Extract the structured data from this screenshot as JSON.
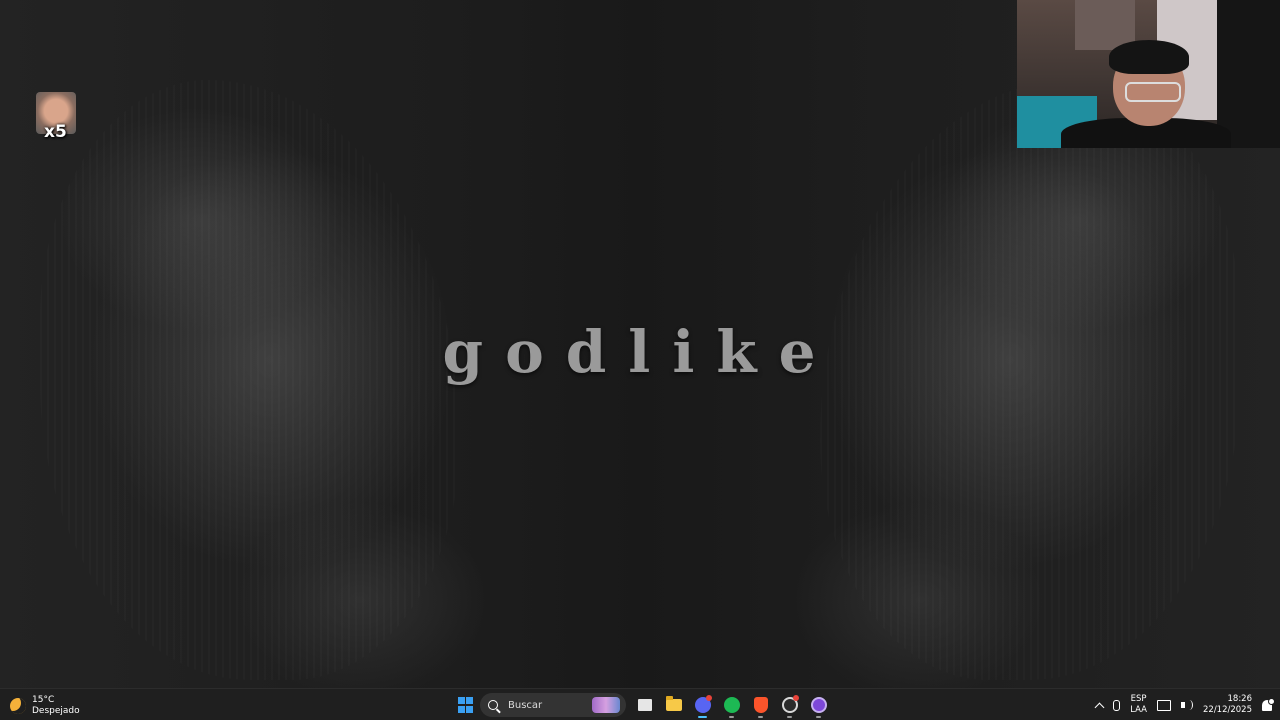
{
  "wallpaper": {
    "headline": "godlike"
  },
  "desktop_icons": [
    {
      "label": "x5"
    }
  ],
  "taskbar": {
    "weather": {
      "temp": "15°C",
      "condition": "Despejado",
      "icon": "moon-icon"
    },
    "search": {
      "placeholder": "Buscar"
    },
    "apps": [
      {
        "name": "task-view",
        "icon": "task-view-icon"
      },
      {
        "name": "file-explorer",
        "icon": "folder-icon"
      },
      {
        "name": "discord",
        "icon": "discord-icon"
      },
      {
        "name": "spotify",
        "icon": "spotify-icon"
      },
      {
        "name": "brave",
        "icon": "brave-icon"
      },
      {
        "name": "steam",
        "icon": "steam-icon"
      },
      {
        "name": "obs",
        "icon": "obs-icon"
      }
    ],
    "tray": {
      "language": "ESP",
      "layout": "LAA",
      "time": "18:26",
      "date": "22/12/2025"
    }
  },
  "colors": {
    "accent": "#4cc2ff",
    "taskbar_bg": "#1f1f1f",
    "start_blue": "#3aa0f3"
  }
}
